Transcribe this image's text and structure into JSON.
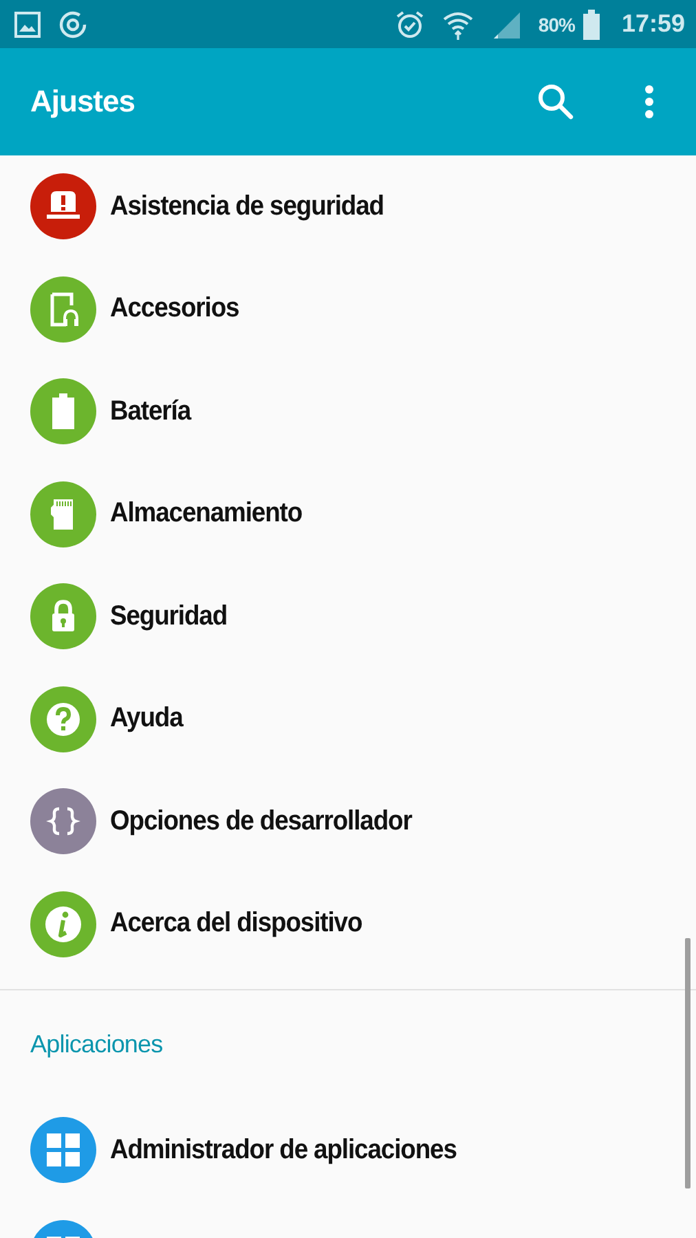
{
  "status_bar": {
    "battery_text": "80%",
    "time": "17:59"
  },
  "app_bar": {
    "title": "Ajustes"
  },
  "sections": [
    {
      "items": [
        {
          "label": "Asistencia de seguridad",
          "kind": "alert",
          "color": "#c81e0a"
        },
        {
          "label": "Accesorios",
          "kind": "accessory",
          "color": "#6cb52d"
        },
        {
          "label": "Batería",
          "kind": "battery",
          "color": "#6cb52d"
        },
        {
          "label": "Almacenamiento",
          "kind": "storage",
          "color": "#6cb52d"
        },
        {
          "label": "Seguridad",
          "kind": "lock",
          "color": "#6cb52d"
        },
        {
          "label": "Ayuda",
          "kind": "help",
          "color": "#6cb52d"
        },
        {
          "label": "Opciones de desarrollador",
          "kind": "braces",
          "color": "#8c8299"
        },
        {
          "label": "Acerca del dispositivo",
          "kind": "info",
          "color": "#6cb52d"
        }
      ]
    },
    {
      "header": "Aplicaciones",
      "items": [
        {
          "label": "Administrador de aplicaciones",
          "kind": "grid",
          "color": "#1f9be6"
        },
        {
          "kind": "grid",
          "color": "#1f9be6"
        }
      ]
    }
  ]
}
